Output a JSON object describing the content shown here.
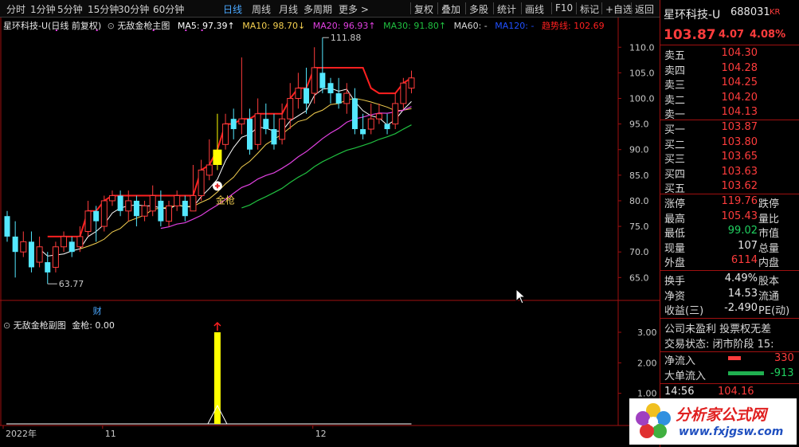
{
  "toolbar": {
    "periods": [
      "分时",
      "1分钟",
      "5分钟",
      "15分钟",
      "30分钟",
      "60分钟",
      "日线",
      "周线",
      "月线",
      "多周期",
      "更多 >"
    ],
    "selected": "日线",
    "actions": [
      "复权",
      "叠加",
      "多股",
      "统计",
      "画线",
      "F10",
      "标记",
      "+自选",
      "返回"
    ]
  },
  "main_header": {
    "stock": "星环科技-U",
    "adjust": "(日线 前复权)",
    "indicator": "无敌金枪主图",
    "ma5": "MA5: 97.39↑",
    "ma10": "MA10: 98.70↓",
    "ma20": "MA20: 96.93↑",
    "ma30": "MA30: 91.80↑",
    "ma60": "MA60: -",
    "ma120": "MA120: -",
    "trend": "趋势线: 102.69"
  },
  "chart_labels": {
    "high_marker": "111.88",
    "low_marker": "63.77",
    "jinqiang": "金枪",
    "cai": "财"
  },
  "sub_header": {
    "indicator": "无敌金枪副图",
    "value": "金枪: 0.00"
  },
  "x_axis": [
    "2022年",
    "11",
    "12"
  ],
  "colors": {
    "up": "#ff3c3c",
    "down": "#54e8ff",
    "ma5": "#ffffff",
    "ma10": "#f5d050",
    "ma20": "#e040e0",
    "ma30": "#20c040",
    "trend": "#ff2020",
    "jinqiang_bar": "#ffff00"
  },
  "chart_data": {
    "type": "candlestick",
    "y_ticks": [
      110,
      105,
      100,
      95,
      90,
      85,
      80,
      75,
      70,
      65
    ],
    "ylim": [
      61,
      113
    ],
    "sub_y_ticks": [
      "3.00",
      "2.00",
      "1.00"
    ],
    "sub_ylim": [
      0,
      3.6
    ],
    "candles": [
      [
        77,
        73,
        78,
        72
      ],
      [
        73,
        70,
        76,
        65
      ],
      [
        70,
        72,
        74,
        69
      ],
      [
        72,
        67,
        74,
        66
      ],
      [
        68,
        71,
        73,
        67
      ],
      [
        68,
        66,
        70,
        63.77
      ],
      [
        67,
        71,
        72,
        66
      ],
      [
        71,
        73,
        74,
        70
      ],
      [
        72,
        70,
        73,
        69
      ],
      [
        71,
        73,
        75,
        70
      ],
      [
        74,
        78,
        80,
        73
      ],
      [
        78,
        76,
        79,
        72
      ],
      [
        75,
        80,
        81,
        74
      ],
      [
        80,
        81,
        82,
        79
      ],
      [
        81,
        78,
        82,
        77
      ],
      [
        78,
        80,
        82,
        76
      ],
      [
        80,
        77,
        81,
        75
      ],
      [
        77,
        79,
        80,
        76
      ],
      [
        78,
        81,
        83,
        77
      ],
      [
        80,
        76,
        82,
        75
      ],
      [
        76,
        79,
        80,
        75
      ],
      [
        79,
        81,
        82,
        78
      ],
      [
        80,
        77,
        81,
        76
      ],
      [
        78,
        81,
        87,
        78
      ],
      [
        81,
        86,
        88,
        80
      ],
      [
        85,
        87,
        92,
        84
      ],
      [
        87,
        90,
        97,
        86
      ],
      [
        91,
        95,
        97,
        90
      ],
      [
        96,
        94,
        98,
        92
      ],
      [
        95,
        96,
        108,
        93
      ],
      [
        96,
        90,
        98,
        89
      ],
      [
        91,
        97,
        100,
        90
      ],
      [
        96,
        94,
        99,
        93
      ],
      [
        94,
        91,
        97,
        90
      ],
      [
        92,
        96,
        99,
        91
      ],
      [
        96,
        100,
        103,
        94
      ],
      [
        100,
        102,
        105,
        98
      ],
      [
        102,
        99,
        106,
        97
      ],
      [
        101,
        106,
        110,
        99
      ],
      [
        105,
        102,
        111.88,
        101
      ],
      [
        103,
        101,
        104,
        99
      ],
      [
        101,
        99,
        104,
        98
      ],
      [
        99,
        101,
        103,
        97
      ],
      [
        100,
        94,
        102,
        93
      ],
      [
        94,
        93,
        97,
        92
      ],
      [
        94,
        96,
        99,
        93
      ],
      [
        96,
        97,
        99,
        95
      ],
      [
        95,
        94,
        97,
        93
      ],
      [
        95,
        99,
        101,
        94
      ],
      [
        99,
        103,
        104,
        98
      ],
      [
        102,
        104,
        105.43,
        101
      ]
    ],
    "jinqiang_signal_index": 26,
    "jinqiang_value": 3.0
  },
  "quote": {
    "name": "星环科技-U",
    "code": "688031",
    "badge": "KR",
    "price": "103.87",
    "change": "4.07",
    "pct": "4.08%",
    "asks": [
      {
        "label": "卖五",
        "price": "104.30"
      },
      {
        "label": "卖四",
        "price": "104.28"
      },
      {
        "label": "卖三",
        "price": "104.25"
      },
      {
        "label": "卖二",
        "price": "104.20"
      },
      {
        "label": "卖一",
        "price": "104.13"
      }
    ],
    "bids": [
      {
        "label": "买一",
        "price": "103.87"
      },
      {
        "label": "买二",
        "price": "103.80"
      },
      {
        "label": "买三",
        "price": "103.65"
      },
      {
        "label": "买四",
        "price": "103.63"
      },
      {
        "label": "买五",
        "price": "103.62"
      }
    ],
    "stats": [
      {
        "label": "涨停",
        "value": "119.76",
        "label2": "跌停"
      },
      {
        "label": "最高",
        "value": "105.43",
        "label2": "量比"
      },
      {
        "label": "最低",
        "value": "99.02",
        "label2": "市值"
      },
      {
        "label": "现量",
        "value": "107",
        "label2": "总量"
      },
      {
        "label": "外盘",
        "value": "6114",
        "label2": "内盘"
      }
    ],
    "fin": [
      {
        "label": "换手",
        "value": "4.49%",
        "label2": "股本"
      },
      {
        "label": "净资",
        "value": "14.53",
        "label2": "流通"
      },
      {
        "label": "收益(三)",
        "value": "-2.490",
        "label2": "PE(动)"
      }
    ],
    "notes": [
      "公司未盈利 投票权无差",
      "交易状态: 闭市阶段 15:"
    ],
    "flows": [
      {
        "label": "净流入",
        "value": "330"
      },
      {
        "label": "大单流入",
        "value": "-913"
      }
    ],
    "tick": {
      "time": "14:56",
      "price": "104.16"
    }
  },
  "watermark": {
    "name": "分析家公式网",
    "url": "www.fxjgsw.com"
  }
}
